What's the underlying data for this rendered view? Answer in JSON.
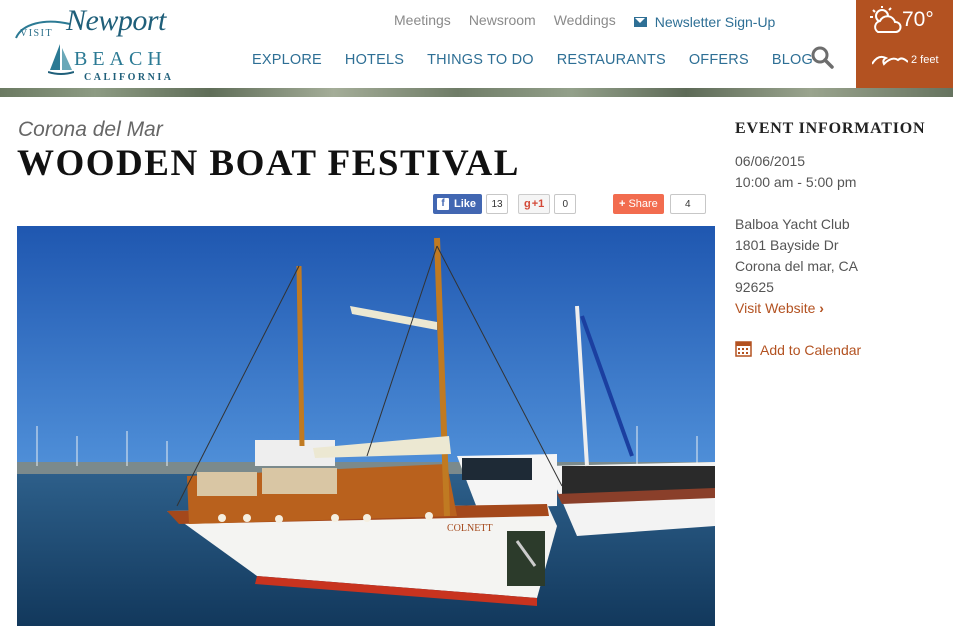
{
  "brand": {
    "visit": "VISIT",
    "name_script": "Newport",
    "name_caps": "BEACH",
    "region": "CALIFORNIA"
  },
  "utility_nav": [
    "Meetings",
    "Newsroom",
    "Weddings"
  ],
  "newsletter_label": "Newsletter Sign-Up",
  "main_nav": [
    "EXPLORE",
    "HOTELS",
    "THINGS TO DO",
    "RESTAURANTS",
    "OFFERS",
    "BLOG"
  ],
  "weather": {
    "temperature": "70°",
    "surf": "2 feet"
  },
  "page": {
    "subtitle": "Corona del Mar",
    "title": "WOODEN BOAT FESTIVAL"
  },
  "social": {
    "facebook_label": "Like",
    "facebook_count": "13",
    "gplus_label": "+1",
    "gplus_count": "0",
    "share_label": "Share",
    "share_count": "4"
  },
  "event": {
    "heading": "EVENT INFORMATION",
    "date": "06/06/2015",
    "time": "10:00 am - 5:00 pm",
    "venue": "Balboa Yacht Club",
    "address_line": "1801 Bayside Dr",
    "city": "Corona del mar, CA",
    "zip": "92625",
    "website_link": "Visit Website",
    "calendar_link": "Add to Calendar"
  },
  "colors": {
    "accent": "#b35221",
    "nav": "#2e6f95"
  }
}
